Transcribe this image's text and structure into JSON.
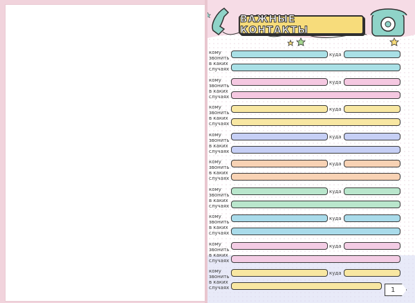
{
  "header": {
    "title": "ВАЖНЫЕ КОНТАКТЫ"
  },
  "labels": {
    "who": "кому звонить",
    "when": "в каких случаях",
    "where": "куда"
  },
  "rows": [
    {
      "color": "#a9e0e6"
    },
    {
      "color": "#f5c8e1"
    },
    {
      "color": "#f8e7a2"
    },
    {
      "color": "#c6cff5"
    },
    {
      "color": "#f8d2b4"
    },
    {
      "color": "#b9e6cc"
    },
    {
      "color": "#a9dbea"
    },
    {
      "color": "#f3cce4"
    },
    {
      "color": "#f8e7a2"
    }
  ],
  "colors": {
    "accent_yellow": "#f7dc7b",
    "outline": "#2f2f2f",
    "left_border": "#f1d3dc",
    "phone_teal": "#8fd3c8"
  },
  "icons": [
    "telephone-handset-icon",
    "rotary-phone-icon",
    "star-icon"
  ],
  "page_number": "1"
}
